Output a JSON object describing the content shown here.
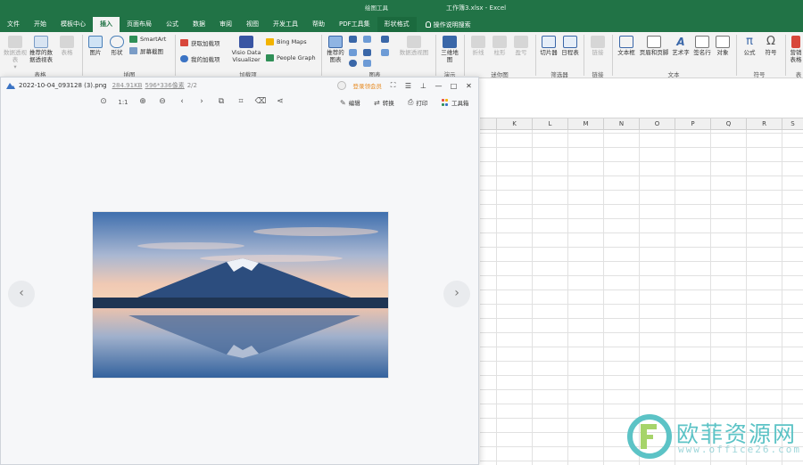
{
  "window": {
    "context_group_label": "绘图工具",
    "title": "工作簿3.xlsx - Excel"
  },
  "tabs": [
    {
      "label": "文件"
    },
    {
      "label": "开始"
    },
    {
      "label": "模板中心"
    },
    {
      "label": "插入",
      "active": true
    },
    {
      "label": "页面布局"
    },
    {
      "label": "公式"
    },
    {
      "label": "数据"
    },
    {
      "label": "审阅"
    },
    {
      "label": "视图"
    },
    {
      "label": "开发工具"
    },
    {
      "label": "帮助"
    },
    {
      "label": "PDF工具集"
    },
    {
      "label": "形状格式",
      "contextual": true
    }
  ],
  "tell_me": "操作说明搜索",
  "ribbon": {
    "pivot_table": "数据透视表",
    "pivot_table_arrow": "▾",
    "recommended_pivot": "推荐的数据透视表",
    "table": "表格",
    "group_tables": "表格",
    "pictures": "图片",
    "shapes": "形状",
    "smartart": "SmartArt",
    "screenshot": "屏幕截图",
    "group_illustrations": "插图",
    "get_addins": "获取加载项",
    "my_addins": "我的加载项",
    "visio": "Visio Data Visualizer",
    "bing_maps": "Bing Maps",
    "people_graph": "People Graph",
    "group_addins": "加载项",
    "recommended_charts": "推荐的图表",
    "pivot_chart": "数据透视图",
    "group_charts": "图表",
    "map3d": "三维地图",
    "group_tours": "演示",
    "spark_line": "折线",
    "spark_column": "柱形",
    "spark_winloss": "盈亏",
    "group_sparklines": "迷你图",
    "slicer": "切片器",
    "timeline": "日程表",
    "group_filters": "筛选器",
    "link": "链接",
    "group_links": "链接",
    "textbox": "文本框",
    "header_footer": "页眉和页脚",
    "wordart": "艺术字",
    "signature": "签名行",
    "object": "对象",
    "group_text": "文本",
    "equation": "公式",
    "symbol": "符号",
    "group_symbols": "符号",
    "cut_1": "营销",
    "cut_2": "表格",
    "cut_group": "表"
  },
  "columns": [
    "K",
    "L",
    "M",
    "N",
    "O",
    "P",
    "Q",
    "R",
    "S"
  ],
  "viewer": {
    "filename": "2022-10-04_093128 (3).png",
    "filesize": "284.91KB",
    "dimensions": "596*336像素",
    "page": "2/2",
    "login": "登录领会员",
    "edit": "编辑",
    "convert": "转换",
    "print": "打印",
    "toolbox": "工具箱",
    "prev": "‹",
    "next": "›"
  },
  "watermark": {
    "text": "欧菲资源网",
    "url": "www.office26.com"
  },
  "colors": {
    "excel_green": "#217346",
    "accent_orange": "#e6891f",
    "watermark_teal": "#5cc3c6"
  },
  "icons": [
    "lightbulb-icon",
    "mountain-logo-icon",
    "pointer-icon",
    "actual-size-icon",
    "zoom-in-icon",
    "zoom-out-icon",
    "rotate-left-icon",
    "rotate-right-icon",
    "copy-icon",
    "crop-icon",
    "delete-icon",
    "share-icon",
    "edit-icon",
    "convert-icon",
    "print-icon",
    "toolbox-icon",
    "fullscreen-icon",
    "menu-icon",
    "pin-icon",
    "minimize-icon",
    "maximize-icon",
    "close-icon"
  ]
}
